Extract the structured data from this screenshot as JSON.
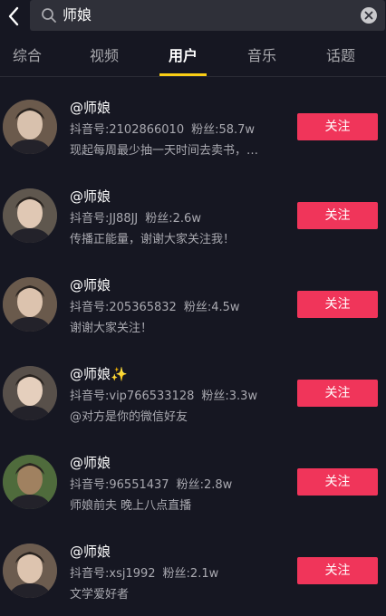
{
  "search": {
    "query": "师娘"
  },
  "tabs": [
    {
      "label": "综合"
    },
    {
      "label": "视频"
    },
    {
      "label": "用户"
    },
    {
      "label": "音乐"
    },
    {
      "label": "话题"
    }
  ],
  "active_tab": "用户",
  "colors": {
    "accent": "#f0355a",
    "tab_indicator": "#face15",
    "background": "#161722"
  },
  "users": [
    {
      "name": "@师娘",
      "id_label": "抖音号:2102866010",
      "fans_label": "粉丝:58.7w",
      "bio": "现起每周最少抽一天时间去卖书，…",
      "follow_label": "关注"
    },
    {
      "name": "@师娘",
      "id_label": "抖音号:JJ88JJ",
      "fans_label": "粉丝:2.6w",
      "bio": "传播正能量，谢谢大家关注我！",
      "follow_label": "关注"
    },
    {
      "name": "@师娘",
      "id_label": "抖音号:205365832",
      "fans_label": "粉丝:4.5w",
      "bio": "谢谢大家关注！",
      "follow_label": "关注"
    },
    {
      "name": "@师娘✨",
      "id_label": "抖音号:vip766533128",
      "fans_label": "粉丝:3.3w",
      "bio": "@对方是你的微信好友",
      "follow_label": "关注"
    },
    {
      "name": "@师娘",
      "id_label": "抖音号:96551437",
      "fans_label": "粉丝:2.8w",
      "bio": "师娘前夫 晚上八点直播",
      "follow_label": "关注"
    },
    {
      "name": "@师娘",
      "id_label": "抖音号:xsj1992",
      "fans_label": "粉丝:2.1w",
      "bio": "文学爱好者",
      "follow_label": "关注"
    }
  ]
}
